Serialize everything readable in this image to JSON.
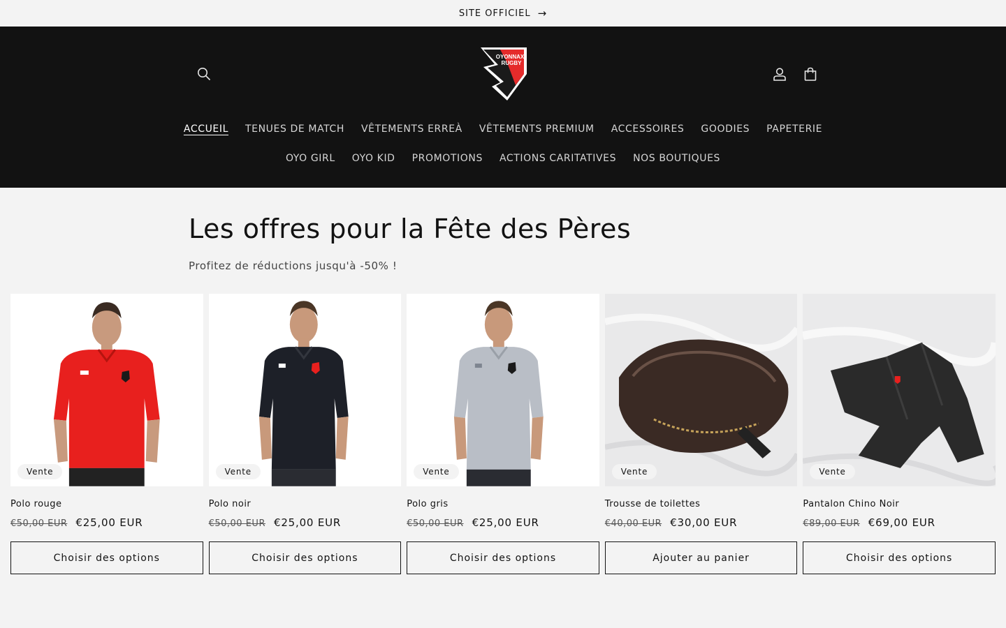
{
  "announcement": {
    "text": "SITE OFFICIEL",
    "arrow": "→"
  },
  "header": {
    "search_icon": "search-icon",
    "account_icon": "user-icon",
    "cart_icon": "bag-icon",
    "logo_text_1": "OYONNAX",
    "logo_text_2": "RUGBY",
    "colors": {
      "background": "#121212",
      "accent": "#e52b2b"
    }
  },
  "nav": {
    "row1": [
      "ACCUEIL",
      "TENUES DE MATCH",
      "VÊTEMENTS ERREÀ",
      "VÊTEMENTS PREMIUM",
      "ACCESSOIRES",
      "GOODIES",
      "PAPETERIE"
    ],
    "row2": [
      "OYO GIRL",
      "OYO KID",
      "PROMOTIONS",
      "ACTIONS CARITATIVES",
      "NOS BOUTIQUES"
    ],
    "active": "ACCUEIL"
  },
  "section": {
    "title": "Les offres pour la Fête des Pères",
    "subtitle": "Profitez de réductions jusqu'à -50% !"
  },
  "products": [
    {
      "name": "Polo rouge",
      "badge": "Vente",
      "old_price": "€50,00 EUR",
      "new_price": "€25,00 EUR",
      "button": "Choisir des options",
      "color": "#e8201e"
    },
    {
      "name": "Polo noir",
      "badge": "Vente",
      "old_price": "€50,00 EUR",
      "new_price": "€25,00 EUR",
      "button": "Choisir des options",
      "color": "#1d2028"
    },
    {
      "name": "Polo gris",
      "badge": "Vente",
      "old_price": "€50,00 EUR",
      "new_price": "€25,00 EUR",
      "button": "Choisir des options",
      "color": "#b9bec6"
    },
    {
      "name": "Trousse de toilettes",
      "badge": "Vente",
      "old_price": "€40,00 EUR",
      "new_price": "€30,00 EUR",
      "button": "Ajouter au panier",
      "color": "#3a2a24"
    },
    {
      "name": "Pantalon Chino Noir",
      "badge": "Vente",
      "old_price": "€89,00 EUR",
      "new_price": "€69,00 EUR",
      "button": "Choisir des options",
      "color": "#2a2a2a"
    }
  ]
}
